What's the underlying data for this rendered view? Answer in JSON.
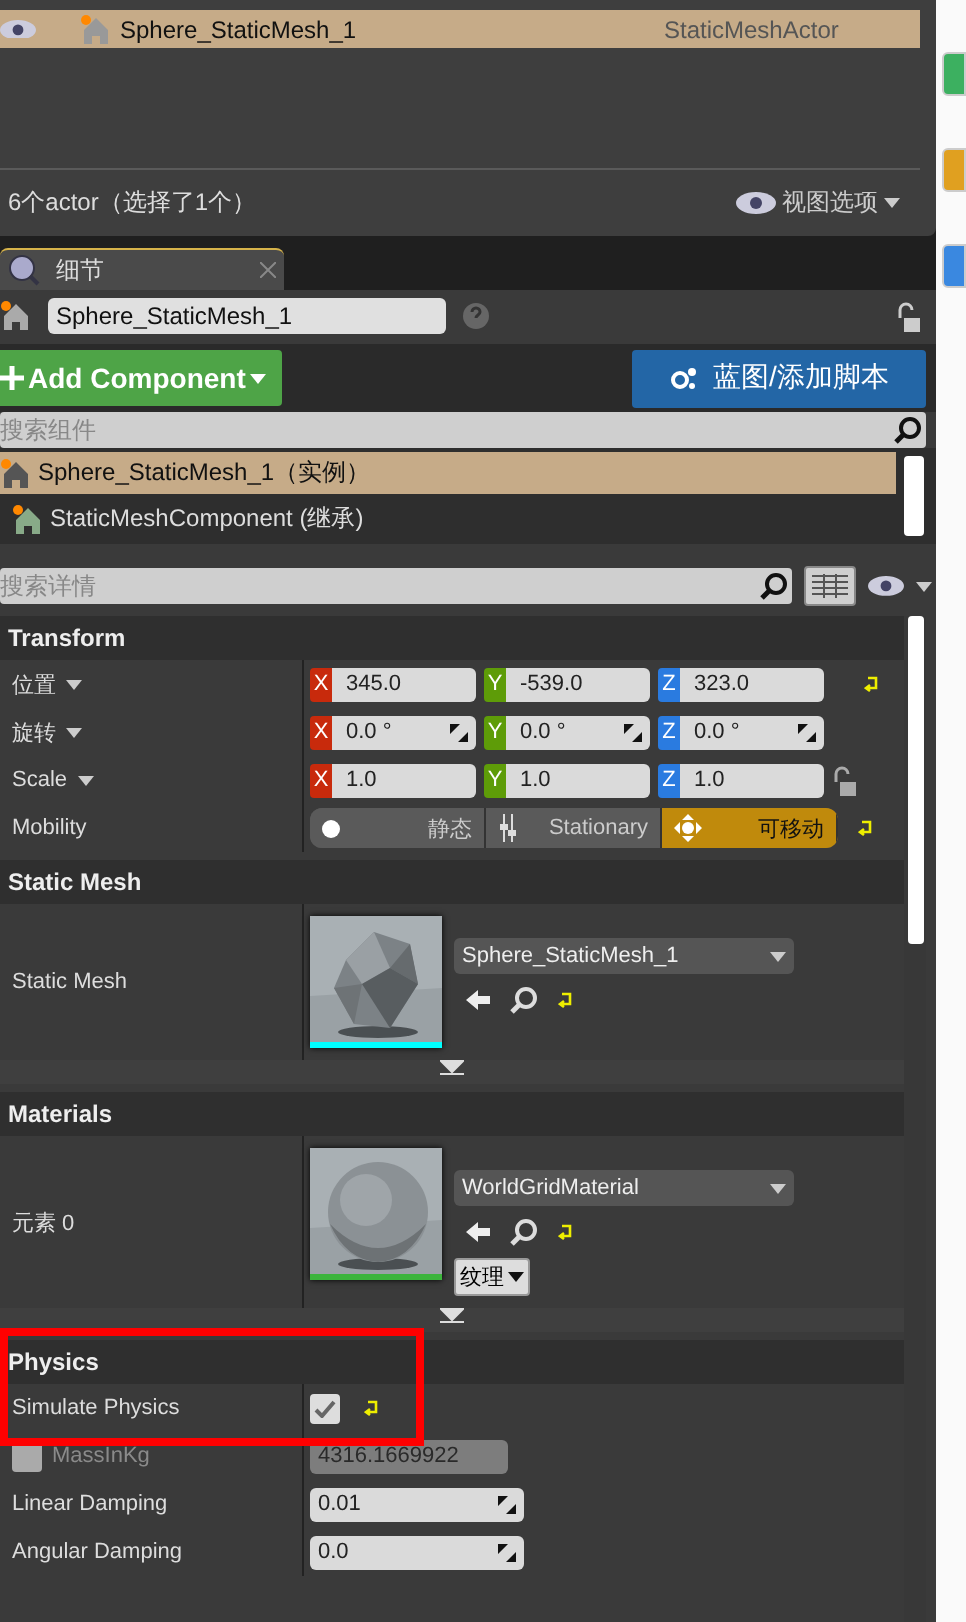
{
  "outliner": {
    "rows": [
      {
        "label": "Sphere_StaticMesh_1",
        "type": "StaticMeshActor",
        "selected": true
      }
    ],
    "status": "6个actor（选择了1个）",
    "view_options": "视图选项"
  },
  "tab": {
    "label": "细节",
    "selected": true
  },
  "details": {
    "name": "Sphere_StaticMesh_1",
    "add_component": "Add Component",
    "blueprint_button": "蓝图/添加脚本",
    "search_components": {
      "placeholder": "搜索组件"
    },
    "components": [
      {
        "label": "Sphere_StaticMesh_1（实例）",
        "selected": true
      },
      {
        "label": "StaticMeshComponent (继承)",
        "selected": false
      }
    ],
    "search_details": {
      "placeholder": "搜索详情"
    }
  },
  "sections": [
    {
      "title": "Transform",
      "rows": [
        {
          "kind": "vector",
          "label": "位置",
          "dropdown": true,
          "reset": true,
          "fields": [
            {
              "axis": "X",
              "value": "345.0",
              "spin": false
            },
            {
              "axis": "Y",
              "value": "-539.0",
              "spin": false
            },
            {
              "axis": "Z",
              "value": "323.0",
              "spin": false
            }
          ]
        },
        {
          "kind": "vector",
          "label": "旋转",
          "dropdown": true,
          "reset": false,
          "fields": [
            {
              "axis": "X",
              "value": "0.0 °",
              "spin": true
            },
            {
              "axis": "Y",
              "value": "0.0 °",
              "spin": true
            },
            {
              "axis": "Z",
              "value": "0.0 °",
              "spin": true
            }
          ]
        },
        {
          "kind": "vector",
          "label": "Scale",
          "dropdown": true,
          "reset": false,
          "lock": true,
          "fields": [
            {
              "axis": "X",
              "value": "1.0",
              "spin": false
            },
            {
              "axis": "Y",
              "value": "1.0",
              "spin": false
            },
            {
              "axis": "Z",
              "value": "1.0",
              "spin": false
            }
          ]
        },
        {
          "kind": "segmented",
          "label": "Mobility",
          "reset": true,
          "options": [
            {
              "label": "静态",
              "selected": false
            },
            {
              "label": "Stationary",
              "selected": false
            },
            {
              "label": "可移动",
              "selected": true
            }
          ]
        }
      ]
    },
    {
      "title": "Static Mesh",
      "expander": true,
      "rows": [
        {
          "kind": "asset",
          "label": "Static Mesh",
          "asset": "Sphere_StaticMesh_1",
          "color": "#00ffff",
          "reset": true
        }
      ]
    },
    {
      "title": "Materials",
      "expander": true,
      "rows": [
        {
          "kind": "asset",
          "label": "元素 0",
          "asset": "WorldGridMaterial",
          "color": "#3cb43c",
          "reset": true,
          "extra": "纹理"
        }
      ]
    },
    {
      "title": "Physics",
      "highlighted": true,
      "rows": [
        {
          "kind": "checkbox",
          "label": "Simulate Physics",
          "checked": true,
          "reset": true
        },
        {
          "kind": "number",
          "label": "MassInKg",
          "disabled": true,
          "override": false,
          "value": "4316.1669922"
        },
        {
          "kind": "number",
          "label": "Linear Damping",
          "disabled": false,
          "value": "0.01"
        },
        {
          "kind": "number",
          "label": "Angular Damping",
          "disabled": false,
          "value": "0.0"
        }
      ]
    }
  ]
}
